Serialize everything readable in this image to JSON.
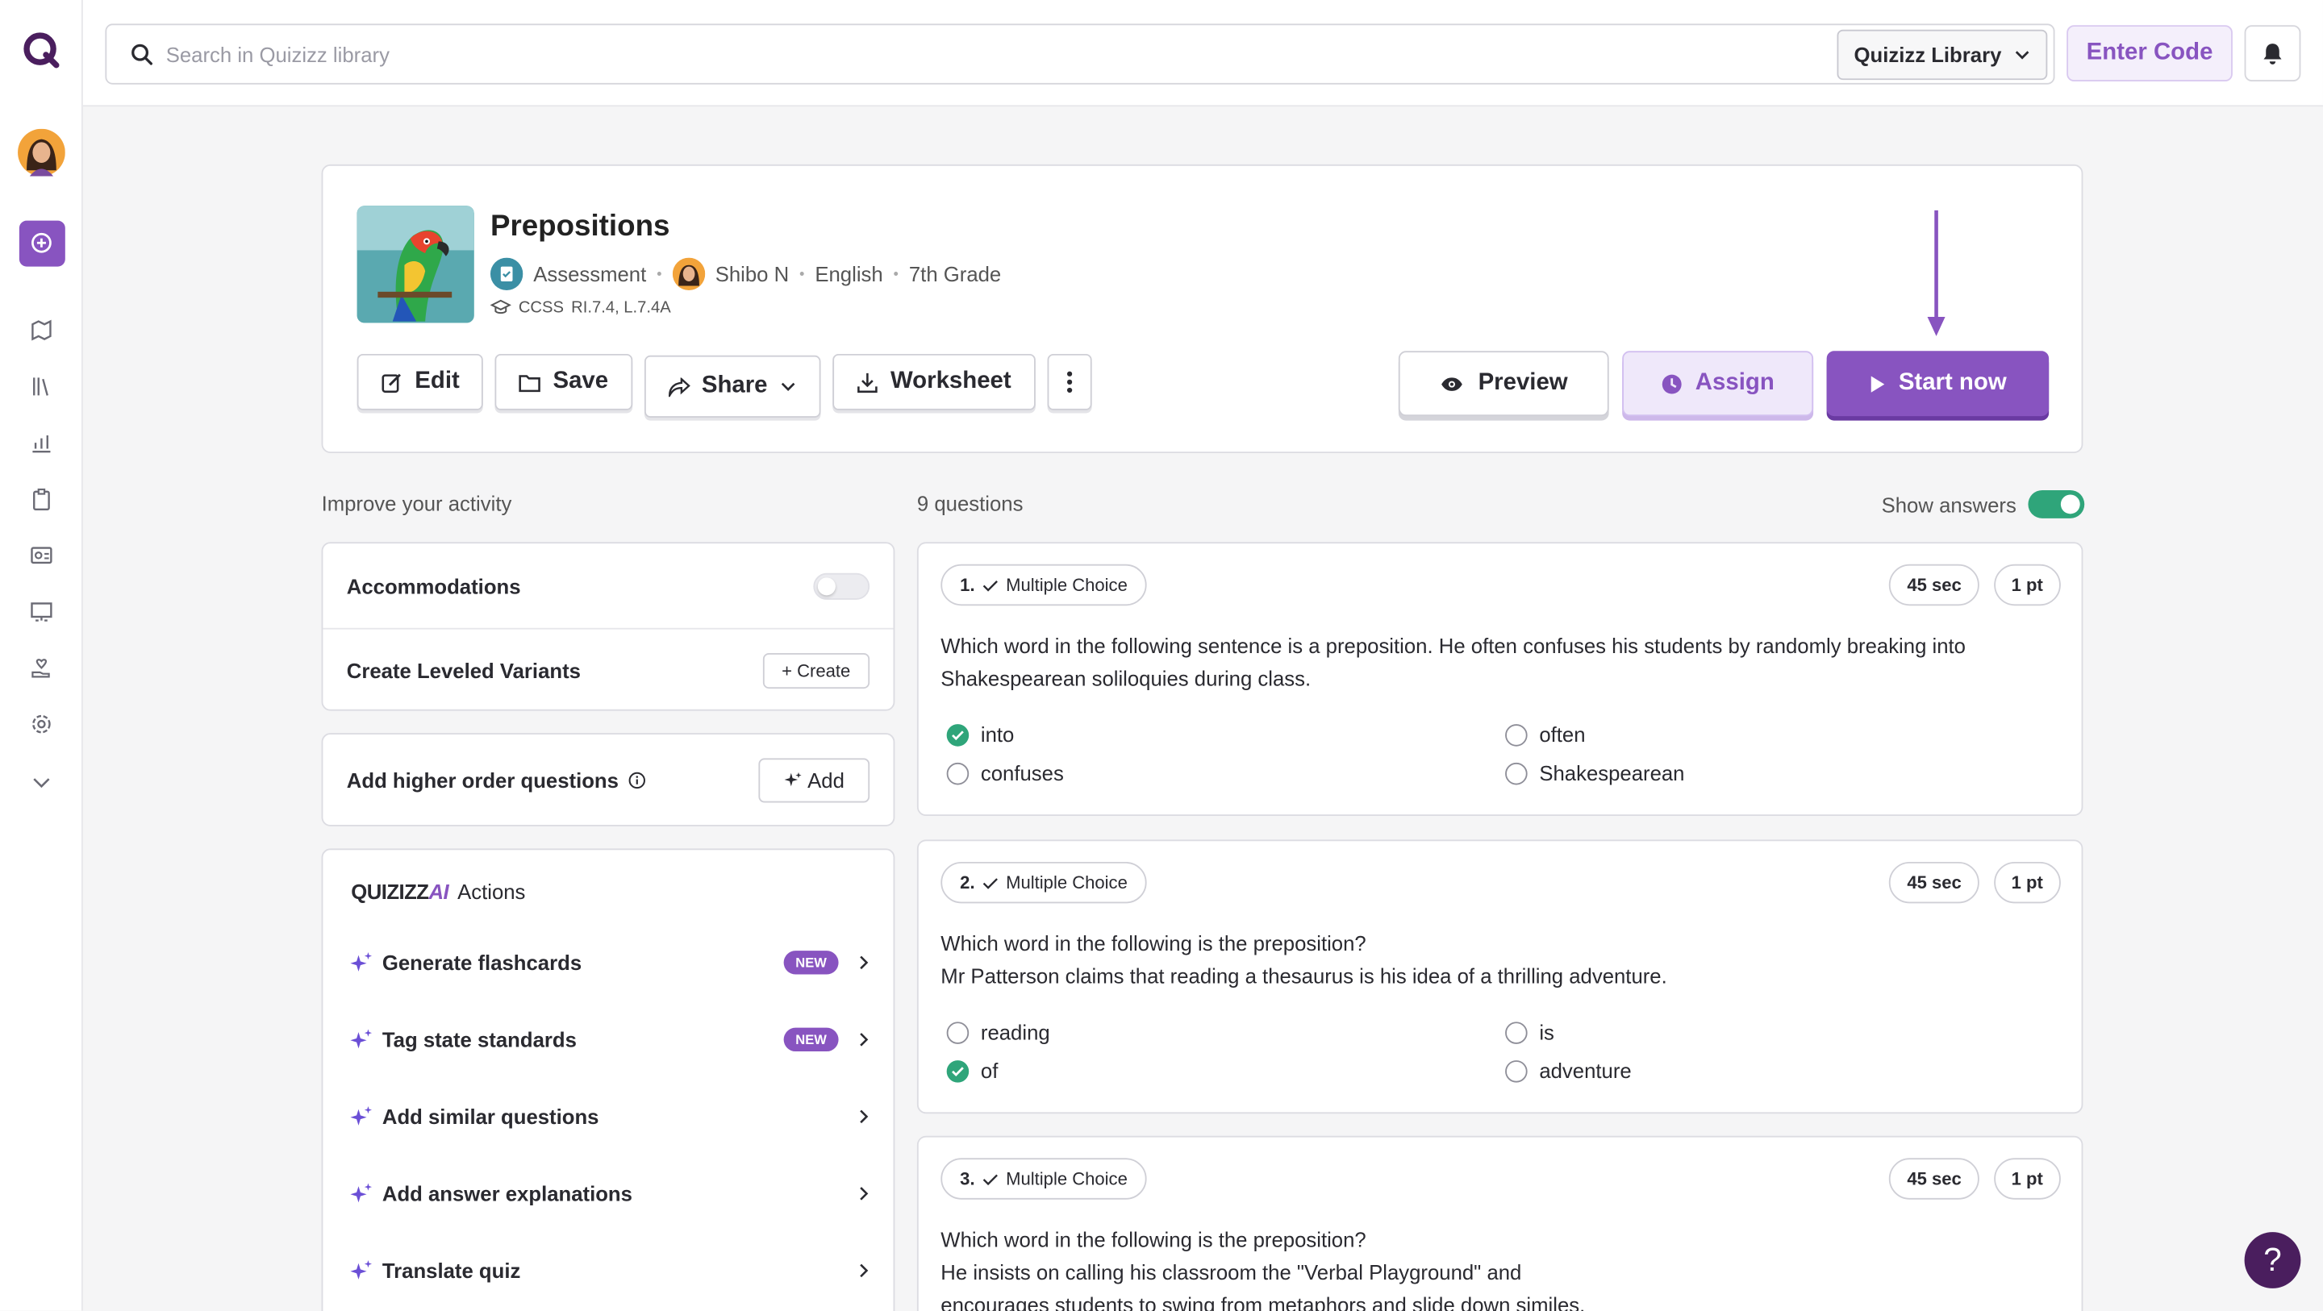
{
  "search": {
    "placeholder": "Search in Quizizz library",
    "scope": "Quizizz Library"
  },
  "header": {
    "enter_code": "Enter Code"
  },
  "quiz": {
    "title": "Prepositions",
    "type": "Assessment",
    "author": "Shibo N",
    "subject": "English",
    "grade": "7th Grade",
    "standards_label": "CCSS",
    "standards": "RI.7.4, L.7.4A",
    "buttons": {
      "edit": "Edit",
      "save": "Save",
      "share": "Share",
      "worksheet": "Worksheet",
      "preview": "Preview",
      "assign": "Assign",
      "start": "Start now"
    }
  },
  "improve": {
    "title": "Improve your activity",
    "accommodations": "Accommodations",
    "leveled": "Create Leveled Variants",
    "create_btn": "+ Create",
    "higher_order": "Add higher order questions",
    "add_btn": "Add",
    "ai_brand_a": "QUIZIZZ",
    "ai_brand_b": "AI",
    "ai_actions": "Actions",
    "actions": [
      {
        "label": "Generate flashcards",
        "badge": "NEW"
      },
      {
        "label": "Tag state standards",
        "badge": "NEW"
      },
      {
        "label": "Add similar questions",
        "badge": ""
      },
      {
        "label": "Add answer explanations",
        "badge": ""
      },
      {
        "label": "Translate quiz",
        "badge": ""
      }
    ]
  },
  "questions_header": {
    "count": "9 questions",
    "show_answers": "Show answers"
  },
  "questions": [
    {
      "num": "1.",
      "type": "Multiple Choice",
      "time": "45 sec",
      "points": "1 pt",
      "text": "Which word in the following sentence is a preposition. He often confuses his students by randomly breaking into Shakespearean soliloquies during class.",
      "options": [
        "into",
        "often",
        "confuses",
        "Shakespearean"
      ],
      "correct": "into"
    },
    {
      "num": "2.",
      "type": "Multiple Choice",
      "time": "45 sec",
      "points": "1 pt",
      "text_line1": "Which word in the following is the preposition?",
      "text_line2": "Mr Patterson claims that reading a thesaurus is his idea of a thrilling adventure.",
      "options": [
        "reading",
        "is",
        "of",
        "adventure"
      ],
      "correct": "of"
    },
    {
      "num": "3.",
      "type": "Multiple Choice",
      "time": "45 sec",
      "points": "1 pt",
      "text_line1": "Which word in the following is the preposition?",
      "text_line2": "He insists on calling his classroom the \"Verbal Playground\" and",
      "text_line3": "encourages students to swing from metaphors and slide down similes."
    }
  ],
  "colors": {
    "brand": "#8854c0",
    "correct": "#2fa57a"
  },
  "help_label": "?"
}
